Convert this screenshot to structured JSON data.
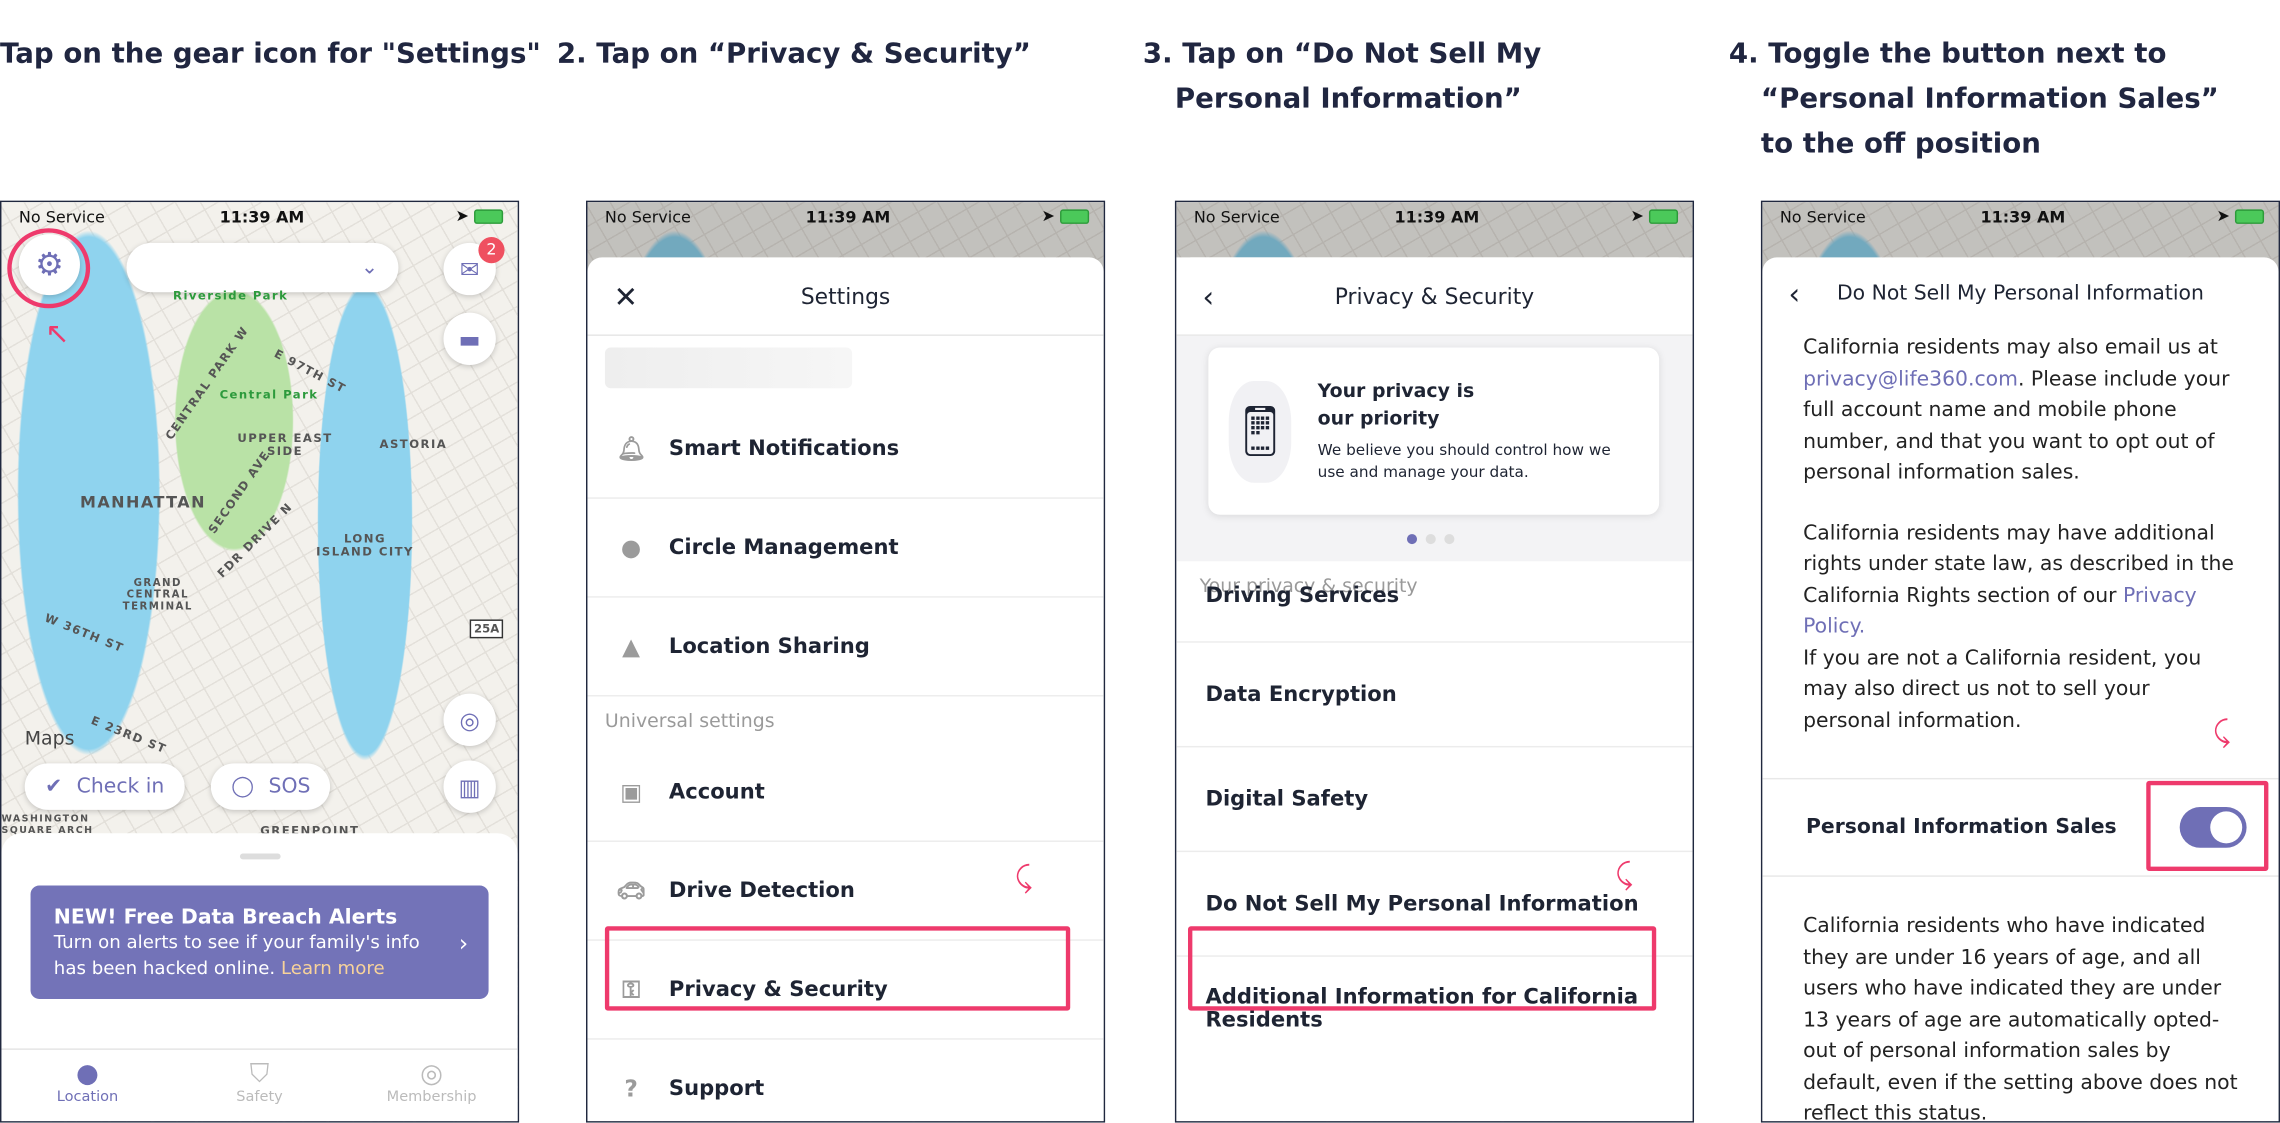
{
  "steps": [
    {
      "label": "Tap on the gear icon for \"Settings\""
    },
    {
      "num": "2.",
      "label": "Tap on “Privacy & Security”"
    },
    {
      "num": "3.",
      "label": "Tap on “Do Not Sell My Personal Information”"
    },
    {
      "num": "4.",
      "label": "Toggle the button next to “Personal Information Sales” to the off position"
    }
  ],
  "status": {
    "carrier": "No Service",
    "time": "11:39 AM"
  },
  "screen1": {
    "badge": "2",
    "map_labels": [
      "Riverside Park",
      "Central Park",
      "UPPER EAST SIDE",
      "ASTORIA",
      "MANHATTAN",
      "LONG ISLAND CITY",
      "GRAND CENTRAL TERMINAL",
      "E 97TH ST",
      "CENTRAL PARK W",
      "SECOND AVE",
      "FDR DRIVE N",
      "W 36TH ST",
      "E 23RD ST",
      "25A",
      "Maps",
      "GREENPOINT",
      "WASHINGTON SQUARE ARCH"
    ],
    "checkin": "Check in",
    "sos": "SOS",
    "banner": {
      "title": "NEW! Free Data Breach Alerts",
      "text": "Turn on alerts to see if your family's info has been hacked online.",
      "link": "Learn more"
    },
    "tabs": [
      "Location",
      "Safety",
      "Membership"
    ]
  },
  "screen2": {
    "title": "Settings",
    "universal": "Universal settings",
    "items": [
      "Smart Notifications",
      "Circle Management",
      "Location Sharing",
      "Account",
      "Drive Detection",
      "Privacy & Security",
      "Support"
    ]
  },
  "screen3": {
    "title": "Privacy & Security",
    "card": {
      "title": "Your privacy is our priority",
      "text": "We believe you should control how we use and manage your data."
    },
    "section": "Your privacy & security",
    "items": [
      "Driving Services",
      "Data Encryption",
      "Digital Safety",
      "Do Not Sell My Personal Information",
      "Additional Information for California Residents"
    ]
  },
  "screen4": {
    "title": "Do Not Sell My Personal Information",
    "p1a": "California residents may also email us at ",
    "email": "privacy@life360.com",
    "p1b": ". Please include your full account name and mobile phone number, and that you want to opt out of personal information sales.",
    "p2a": "California residents may have additional rights under state law, as described in the California Rights section of our ",
    "policy": "Privacy Policy.",
    "p2b": "If you are not a California resident, you may also direct us not to sell your personal information.",
    "toggle_label": "Personal Information Sales",
    "toggle_on": true,
    "p3": "California residents who have indicated they are under 16 years of age, and all users who have indicated they are under 13 years of age are automatically opted-out of personal information sales by default, even if the setting above does not reflect this status."
  },
  "colors": {
    "accent": "#6f6fb6",
    "highlight": "#ee3a6c"
  }
}
